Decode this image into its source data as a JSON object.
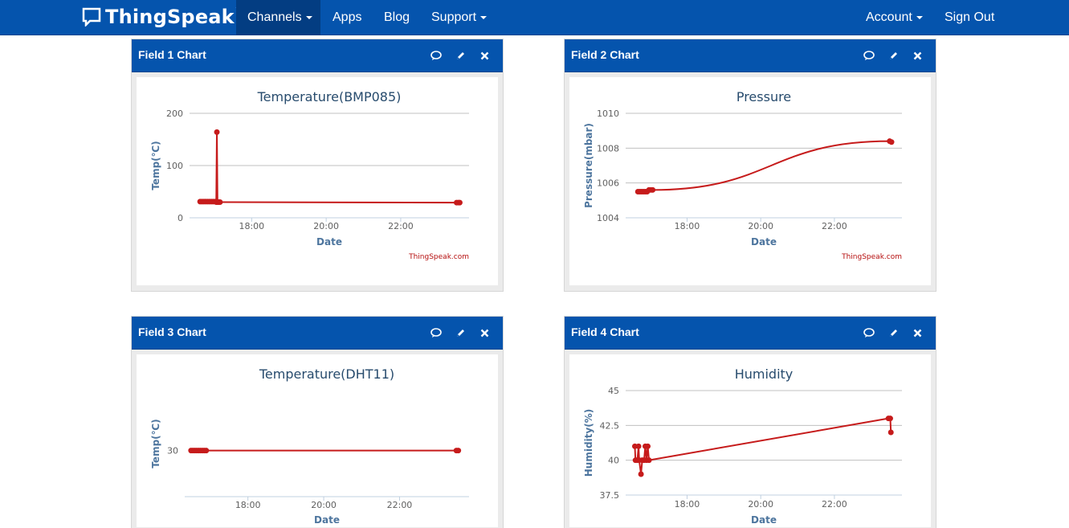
{
  "navbar": {
    "brand": "ThingSpeak",
    "brand_tm": "™",
    "items": [
      {
        "label": "Channels",
        "dropdown": true,
        "active": true
      },
      {
        "label": "Apps",
        "dropdown": false
      },
      {
        "label": "Blog",
        "dropdown": false
      },
      {
        "label": "Support",
        "dropdown": true
      }
    ],
    "right_items": [
      {
        "label": "Account",
        "dropdown": true
      },
      {
        "label": "Sign Out",
        "dropdown": false
      }
    ],
    "colors": {
      "bar": "#0554ad",
      "active": "#033d82"
    }
  },
  "panels": [
    {
      "title": "Field 1 Chart",
      "tools": [
        "comment-icon",
        "pencil-icon",
        "close-icon"
      ]
    },
    {
      "title": "Field 2 Chart",
      "tools": [
        "comment-icon",
        "pencil-icon",
        "close-icon"
      ]
    },
    {
      "title": "Field 3 Chart",
      "tools": [
        "comment-icon",
        "pencil-icon",
        "close-icon"
      ]
    },
    {
      "title": "Field 4 Chart",
      "tools": [
        "comment-icon",
        "pencil-icon",
        "close-icon"
      ]
    }
  ],
  "chart_data": [
    {
      "type": "line",
      "title": "Temperature(BMP085)",
      "xlabel": "Date",
      "ylabel": "Temp(℃)",
      "credit": "ThingSpeak.com",
      "x_ticks": [
        "18:00",
        "20:00",
        "22:00"
      ],
      "y_ticks": [
        0,
        100,
        200
      ],
      "ylim": [
        0,
        200
      ],
      "xlim": [
        "16:20",
        "23:50"
      ],
      "color": "#c61b1b",
      "grid": true,
      "points": [
        [
          "16:37",
          31
        ],
        [
          "16:40",
          31
        ],
        [
          "16:43",
          31
        ],
        [
          "16:46",
          31
        ],
        [
          "16:49",
          31
        ],
        [
          "16:52",
          31
        ],
        [
          "16:55",
          31
        ],
        [
          "16:58",
          31
        ],
        [
          "17:01",
          31
        ],
        [
          "17:03",
          30
        ],
        [
          "17:04",
          164
        ],
        [
          "17:05",
          30
        ],
        [
          "17:07",
          30
        ],
        [
          "17:09",
          30
        ],
        [
          "23:30",
          29
        ],
        [
          "23:33",
          29
        ],
        [
          "23:35",
          29
        ]
      ]
    },
    {
      "type": "line",
      "title": "Pressure",
      "xlabel": "Date",
      "ylabel": "Pressure(mbar)",
      "credit": "ThingSpeak.com",
      "x_ticks": [
        "18:00",
        "20:00",
        "22:00"
      ],
      "y_ticks": [
        1004,
        1006,
        1008,
        1010
      ],
      "ylim": [
        1004,
        1010
      ],
      "xlim": [
        "16:20",
        "23:50"
      ],
      "color": "#c61b1b",
      "grid": true,
      "points": [
        [
          "16:40",
          1005.5
        ],
        [
          "16:43",
          1005.5
        ],
        [
          "16:46",
          1005.5
        ],
        [
          "16:49",
          1005.5
        ],
        [
          "16:52",
          1005.5
        ],
        [
          "16:55",
          1005.5
        ],
        [
          "16:58",
          1005.6
        ],
        [
          "17:01",
          1005.6
        ],
        [
          "17:04",
          1005.6
        ],
        [
          "23:30",
          1008.4
        ],
        [
          "23:33",
          1008.35
        ]
      ]
    },
    {
      "type": "line",
      "title": "Temperature(DHT11)",
      "xlabel": "Date",
      "ylabel": "Temp(℃)",
      "credit": "",
      "x_ticks": [
        "18:00",
        "20:00",
        "22:00"
      ],
      "y_ticks": [
        30
      ],
      "ylim": [
        28,
        32.6
      ],
      "xlim": [
        "16:20",
        "23:50"
      ],
      "color": "#c61b1b",
      "grid": false,
      "points": [
        [
          "16:30",
          30
        ],
        [
          "16:33",
          30
        ],
        [
          "16:36",
          30
        ],
        [
          "16:39",
          30
        ],
        [
          "16:42",
          30
        ],
        [
          "16:45",
          30
        ],
        [
          "16:48",
          30
        ],
        [
          "16:51",
          30
        ],
        [
          "16:54",
          30
        ],
        [
          "23:30",
          30
        ],
        [
          "23:33",
          30
        ]
      ]
    },
    {
      "type": "line",
      "title": "Humidity",
      "xlabel": "Date",
      "ylabel": "Humidity(%)",
      "credit": "",
      "x_ticks": [
        "18:00",
        "20:00",
        "22:00"
      ],
      "y_ticks": [
        37.5,
        40,
        42.5,
        45
      ],
      "ylim": [
        37.5,
        45
      ],
      "xlim": [
        "16:20",
        "23:50"
      ],
      "color": "#c61b1b",
      "grid": true,
      "points": [
        [
          "16:35",
          41
        ],
        [
          "16:36",
          40
        ],
        [
          "16:39",
          40
        ],
        [
          "16:41",
          41
        ],
        [
          "16:42",
          40
        ],
        [
          "16:45",
          39
        ],
        [
          "16:47",
          40
        ],
        [
          "16:50",
          40
        ],
        [
          "16:52",
          41
        ],
        [
          "16:54",
          40
        ],
        [
          "16:56",
          41
        ],
        [
          "16:58",
          40
        ],
        [
          "23:28",
          43
        ],
        [
          "23:31",
          43
        ],
        [
          "23:32",
          42
        ]
      ]
    }
  ]
}
